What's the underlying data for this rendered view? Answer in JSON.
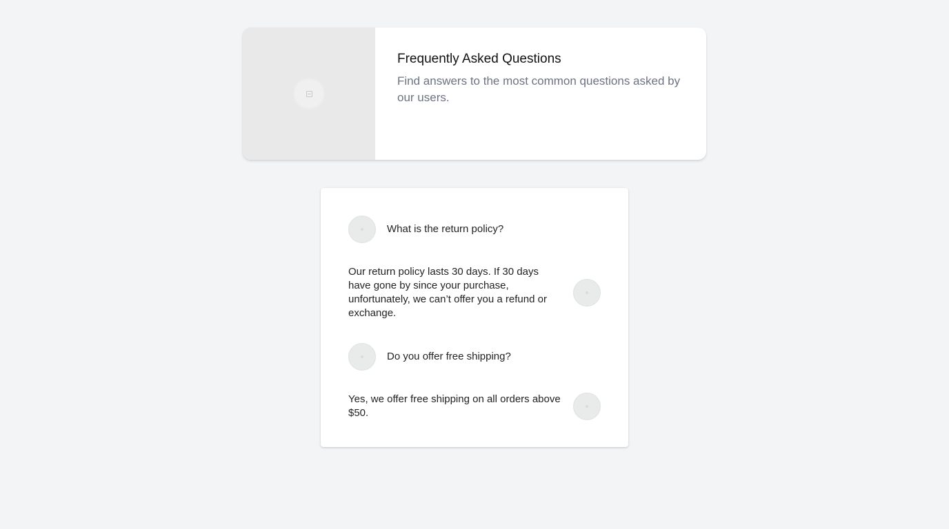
{
  "header": {
    "title": "Frequently Asked Questions",
    "subtitle": "Find answers to the most common questions asked by our users.",
    "image_icon": "image-placeholder-icon"
  },
  "faq": {
    "items": [
      {
        "question": "What is the return policy?",
        "answer": "Our return policy lasts 30 days. If 30 days have gone by since your purchase, unfortunately, we can’t offer you a refund or exchange."
      },
      {
        "question": "Do you offer free shipping?",
        "answer": "Yes, we offer free shipping on all orders above $50."
      }
    ]
  },
  "colors": {
    "background": "#f3f4f6",
    "card": "#ffffff",
    "title": "#111111",
    "subtitle": "#6b7280",
    "body_text": "#222222",
    "avatar": "#e9eaea"
  }
}
